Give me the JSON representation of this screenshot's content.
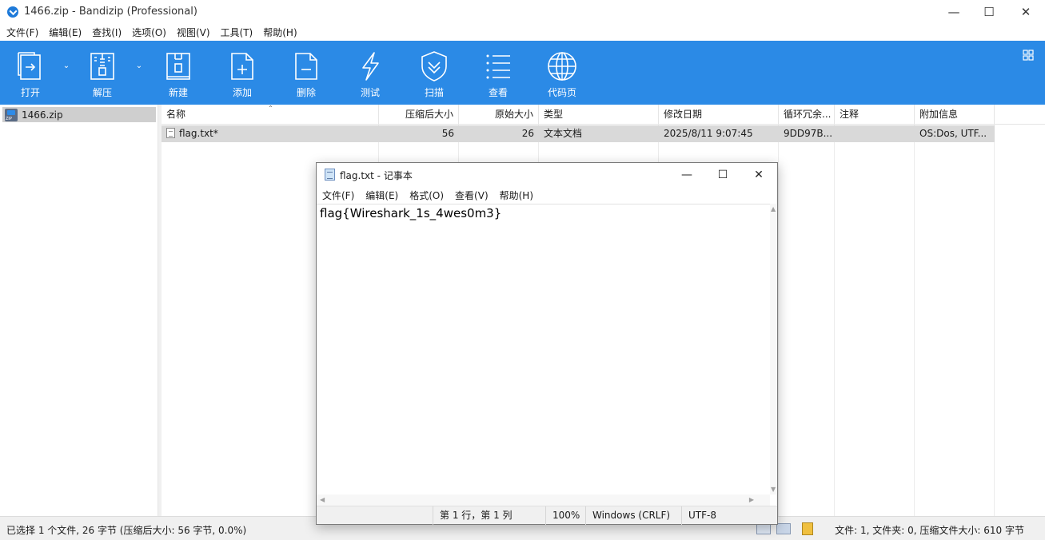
{
  "window": {
    "title": "1466.zip - Bandizip (Professional)"
  },
  "menu": [
    "文件(F)",
    "编辑(E)",
    "查找(I)",
    "选项(O)",
    "视图(V)",
    "工具(T)",
    "帮助(H)"
  ],
  "toolbar": {
    "open": "打开",
    "extract": "解压",
    "new": "新建",
    "add": "添加",
    "delete": "删除",
    "test": "测试",
    "scan": "扫描",
    "view": "查看",
    "codepage": "代码页"
  },
  "tree": {
    "root": "1466.zip"
  },
  "columns": [
    "名称",
    "压缩后大小",
    "原始大小",
    "类型",
    "修改日期",
    "循环冗余...",
    "注释",
    "附加信息"
  ],
  "files": [
    {
      "name": "flag.txt*",
      "compressed": "56",
      "original": "26",
      "type": "文本文档",
      "modified": "2025/8/11 9:07:45",
      "crc": "9DD97B...",
      "comment": "",
      "extra": "OS:Dos, UTF..."
    }
  ],
  "status": {
    "left": "已选择 1 个文件, 26 字节 (压缩后大小: 56 字节, 0.0%)",
    "right": "文件: 1, 文件夹: 0, 压缩文件大小: 610 字节"
  },
  "notepad": {
    "title": "flag.txt - 记事本",
    "menu": [
      "文件(F)",
      "编辑(E)",
      "格式(O)",
      "查看(V)",
      "帮助(H)"
    ],
    "content": "flag{Wireshark_1s_4wes0m3}",
    "status": {
      "position": "第 1 行，第 1 列",
      "zoom": "100%",
      "line_ending": "Windows (CRLF)",
      "encoding": "UTF-8"
    }
  },
  "colors": {
    "toolbar": "#2b8ae6",
    "selection": "#d9d9d9"
  }
}
